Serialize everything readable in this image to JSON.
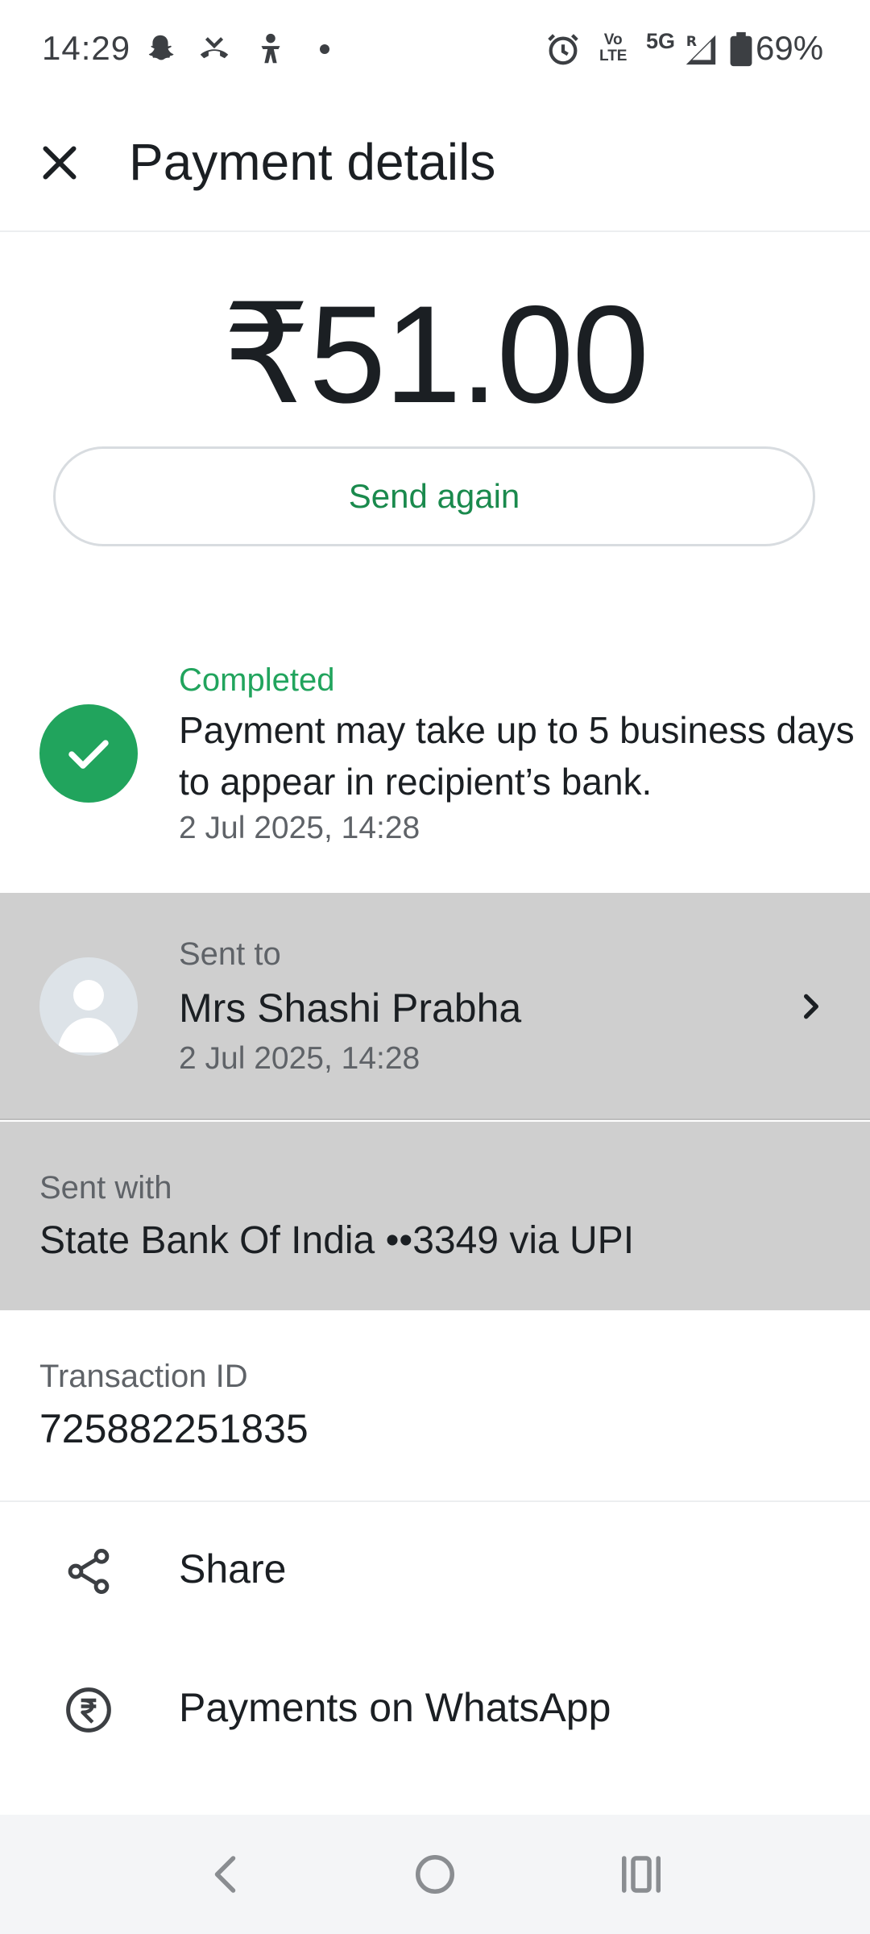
{
  "status_bar": {
    "time": "14:29",
    "volte_top": "Vo",
    "volte_bottom": "LTE",
    "network": "5G",
    "battery": "69%",
    "icons": [
      "snapchat-icon",
      "missed-call-icon",
      "accessibility-icon",
      "dot",
      "alarm-icon",
      "volte-icon",
      "signal-icon",
      "battery-icon"
    ]
  },
  "header": {
    "title": "Payment details",
    "close_icon": "close-icon"
  },
  "payment": {
    "amount": "₹51.00",
    "send_again_label": "Send again"
  },
  "status": {
    "label": "Completed",
    "message": "Payment may take up to 5 business days to appear in recipient’s bank.",
    "date": "2 Jul 2025, 14:28"
  },
  "recipient": {
    "label": "Sent to",
    "name": "Mrs Shashi Prabha",
    "date": "2 Jul 2025, 14:28"
  },
  "payment_method": {
    "label": "Sent with",
    "value": "State Bank Of India ••3349 via UPI"
  },
  "transaction": {
    "label": "Transaction ID",
    "id": "725882251835"
  },
  "actions": [
    {
      "label": "Share",
      "icon": "share-icon"
    },
    {
      "label": "Payments on WhatsApp",
      "icon": "rupee-icon"
    }
  ],
  "colors": {
    "accent_green": "#21a45d",
    "button_text_green": "#1a8a4d",
    "highlight_gray": "#cfcfcf",
    "text_primary": "#1b1f23",
    "text_secondary": "#5f6368"
  }
}
